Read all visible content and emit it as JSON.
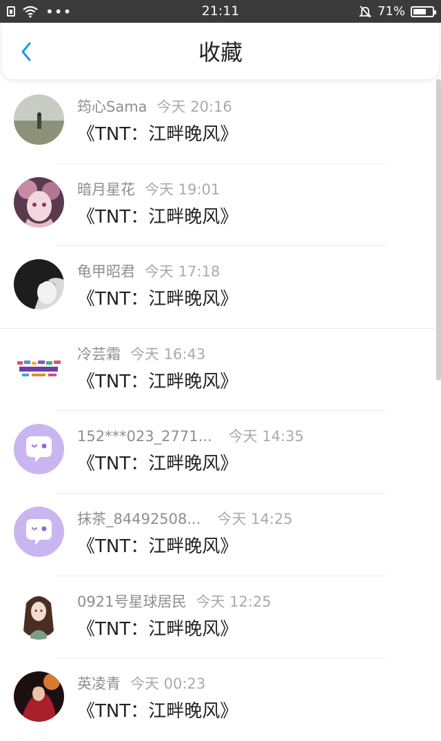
{
  "status_bar": {
    "time": "21:11",
    "battery_text": "71%",
    "battery_level": 0.71,
    "icons": [
      "sim-icon",
      "wifi-icon",
      "more-dots-icon",
      "silent-bell-icon",
      "battery-icon"
    ]
  },
  "header": {
    "back_icon": "chevron-left-icon",
    "title": "收藏",
    "accent_color": "#1e9be6"
  },
  "items": [
    {
      "name": "筠心Sama",
      "time": "今天 20:16",
      "title": "《TNT：江畔晚风》",
      "avatar": "photo-landscape"
    },
    {
      "name": "暗月星花",
      "time": "今天 19:01",
      "title": "《TNT：江畔晚风》",
      "avatar": "photo-anime-girl"
    },
    {
      "name": "龟甲昭君",
      "time": "今天 17:18",
      "title": "《TNT：江畔晚风》",
      "avatar": "photo-dark-portrait"
    },
    {
      "name": "冷芸霜",
      "time": "今天 16:43",
      "title": "《TNT：江畔晚风》",
      "avatar": "image-colorful-text"
    },
    {
      "name": "152***023_2771...",
      "time": "今天 14:35",
      "title": "《TNT：江畔晚风》",
      "avatar": "default-chat-avatar"
    },
    {
      "name": "抹茶_84492508...",
      "time": "今天 14:25",
      "title": "《TNT：江畔晚风》",
      "avatar": "default-chat-avatar"
    },
    {
      "name": "0921号星球居民",
      "time": "今天 12:25",
      "title": "《TNT：江畔晚风》",
      "avatar": "illustration-girl"
    },
    {
      "name": "英凌青",
      "time": "今天 00:23",
      "title": "《TNT：江畔晚风》",
      "avatar": "photo-red-figure"
    }
  ]
}
